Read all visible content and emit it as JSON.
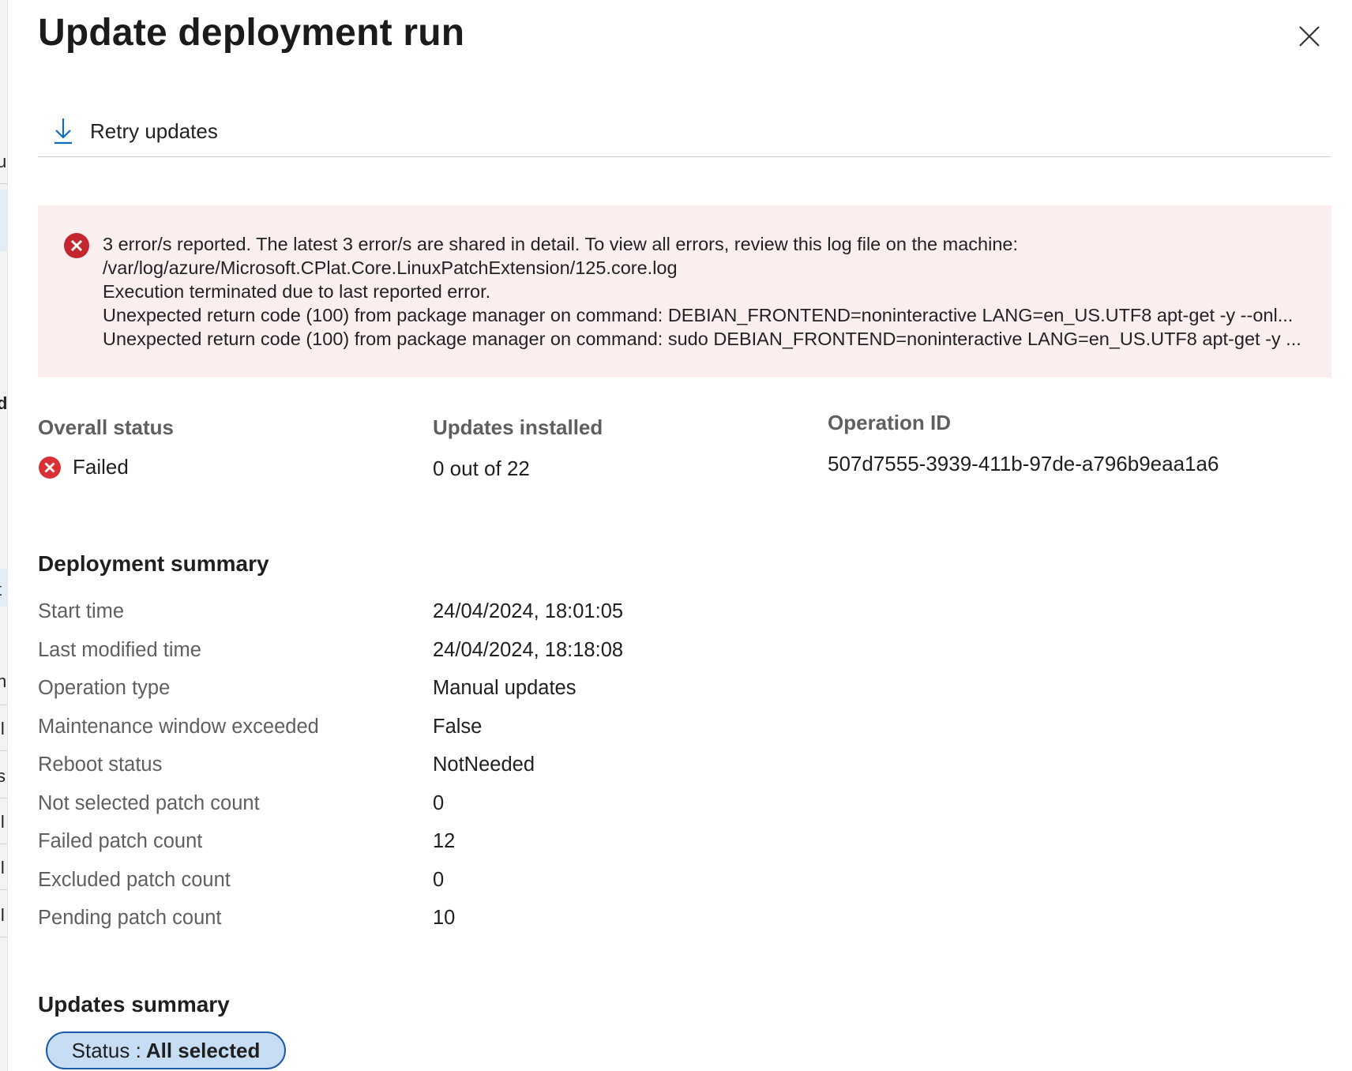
{
  "panel": {
    "title": "Update deployment run"
  },
  "toolbar": {
    "retry_label": "Retry updates"
  },
  "error": {
    "lines": [
      "3 error/s reported. The latest 3 error/s are shared in detail. To view all errors, review this log file on the machine:",
      "/var/log/azure/Microsoft.CPlat.Core.LinuxPatchExtension/125.core.log",
      "Execution terminated due to last reported error.",
      "Unexpected return code (100) from package manager on command: DEBIAN_FRONTEND=noninteractive LANG=en_US.UTF8 apt-get -y --onl...",
      "Unexpected return code (100) from package manager on command: sudo DEBIAN_FRONTEND=noninteractive LANG=en_US.UTF8 apt-get -y ..."
    ]
  },
  "status": {
    "overall_label": "Overall status",
    "overall_value": "Failed",
    "installed_label": "Updates installed",
    "installed_value": "0 out of 22",
    "operation_label": "Operation ID",
    "operation_value": "507d7555-3939-411b-97de-a796b9eaa1a6"
  },
  "deployment_summary": {
    "title": "Deployment summary",
    "rows": [
      {
        "key": "Start time",
        "value": "24/04/2024, 18:01:05"
      },
      {
        "key": "Last modified time",
        "value": "24/04/2024, 18:18:08"
      },
      {
        "key": "Operation type",
        "value": "Manual updates"
      },
      {
        "key": "Maintenance window exceeded",
        "value": "False"
      },
      {
        "key": "Reboot status",
        "value": "NotNeeded"
      },
      {
        "key": "Not selected patch count",
        "value": "0"
      },
      {
        "key": "Failed patch count",
        "value": "12"
      },
      {
        "key": "Excluded patch count",
        "value": "0"
      },
      {
        "key": "Pending patch count",
        "value": "10"
      }
    ]
  },
  "updates_summary": {
    "title": "Updates summary",
    "filter_prefix": "Status :",
    "filter_value": "All selected"
  },
  "background_fragments": [
    "u",
    "d",
    "t",
    "n",
    "ll",
    "s",
    "ll",
    "ll",
    "ll"
  ],
  "colors": {
    "error_bg": "#fbeeee",
    "error_icon": "#c4262e",
    "accent": "#0f6cbd",
    "pill_bg": "#c7ddf3",
    "pill_border": "#1c5aa8"
  },
  "icons": {
    "retry": "download-arrow-icon",
    "close": "close-icon",
    "error": "error-circle-icon"
  }
}
